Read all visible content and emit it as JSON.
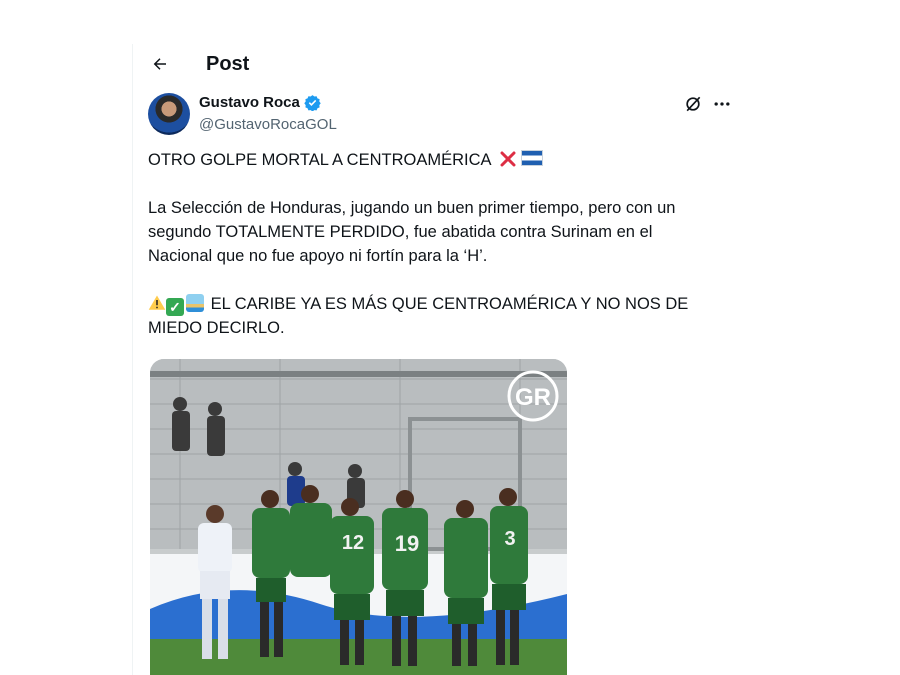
{
  "header": {
    "back_icon": "arrow-left-icon",
    "title": "Post"
  },
  "post": {
    "author": {
      "name": "Gustavo Roca",
      "handle": "@GustavoRocaGOL",
      "verified": true,
      "verified_color": "#1d9bf0"
    },
    "actions": {
      "grok_icon": "grok-icon",
      "more_icon": "more-icon"
    },
    "paragraph1": "OTRO GOLPE MORTAL A CENTROAMÉRICA",
    "paragraph1_emojis": [
      "cross-mark-emoji",
      "honduras-flag-emoji"
    ],
    "paragraph2": "La Selección de Honduras, jugando un buen primer tiempo, pero con un segundo TOTALMENTE PERDIDO, fue abatida contra Surinam en el Nacional que no fue apoyo ni fortín para la ‘H’.",
    "paragraph3_emojis": [
      "warning-emoji",
      "check-mark-emoji",
      "desert-island-emoji"
    ],
    "paragraph3": "EL CARIBE YA ES MÁS QUE CENTROAMÉRICA Y NO NOS DE MIEDO DECIRLO.",
    "media": {
      "watermark": "GR",
      "jersey_numbers": [
        "12",
        "19",
        "3"
      ]
    }
  }
}
